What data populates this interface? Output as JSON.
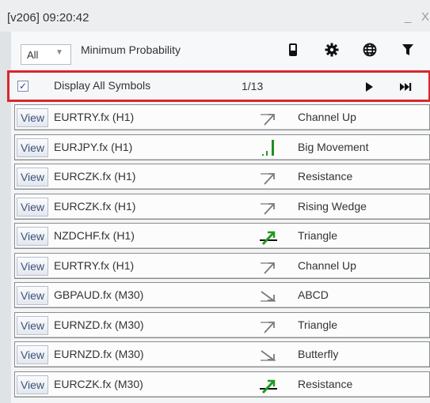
{
  "window": {
    "title": "[v206] 09:20:42",
    "minimize": "_",
    "close": "X"
  },
  "toolbar": {
    "filter_value": "All",
    "probability_label": "Minimum Probability",
    "icons": [
      "phone-icon",
      "gear-icon",
      "globe-icon",
      "filter-icon"
    ]
  },
  "display_row": {
    "checked": true,
    "label": "Display All Symbols",
    "counter": "1/13",
    "icons": [
      "play-icon",
      "skip-forward-icon"
    ]
  },
  "rows": [
    {
      "button": "View",
      "symbol": "EURTRY.fx (H1)",
      "pattern": "Channel Up",
      "icon": "trend-up-gray"
    },
    {
      "button": "View",
      "symbol": "EURJPY.fx (H1)",
      "pattern": "Big Movement",
      "icon": "big-movement-green"
    },
    {
      "button": "View",
      "symbol": "EURCZK.fx (H1)",
      "pattern": "Resistance",
      "icon": "trend-up-gray"
    },
    {
      "button": "View",
      "symbol": "EURCZK.fx (H1)",
      "pattern": "Rising Wedge",
      "icon": "trend-up-gray"
    },
    {
      "button": "View",
      "symbol": "NZDCHF.fx (H1)",
      "pattern": "Triangle",
      "icon": "breakout-up-green"
    },
    {
      "button": "View",
      "symbol": "EURTRY.fx (H1)",
      "pattern": "Channel Up",
      "icon": "trend-up-gray"
    },
    {
      "button": "View",
      "symbol": "GBPAUD.fx (M30)",
      "pattern": "ABCD",
      "icon": "trend-down-gray"
    },
    {
      "button": "View",
      "symbol": "EURNZD.fx (M30)",
      "pattern": "Triangle",
      "icon": "trend-up-gray"
    },
    {
      "button": "View",
      "symbol": "EURNZD.fx (M30)",
      "pattern": "Butterfly",
      "icon": "trend-down-gray"
    },
    {
      "button": "View",
      "symbol": "EURCZK.fx (M30)",
      "pattern": "Resistance",
      "icon": "breakout-up-green"
    }
  ]
}
